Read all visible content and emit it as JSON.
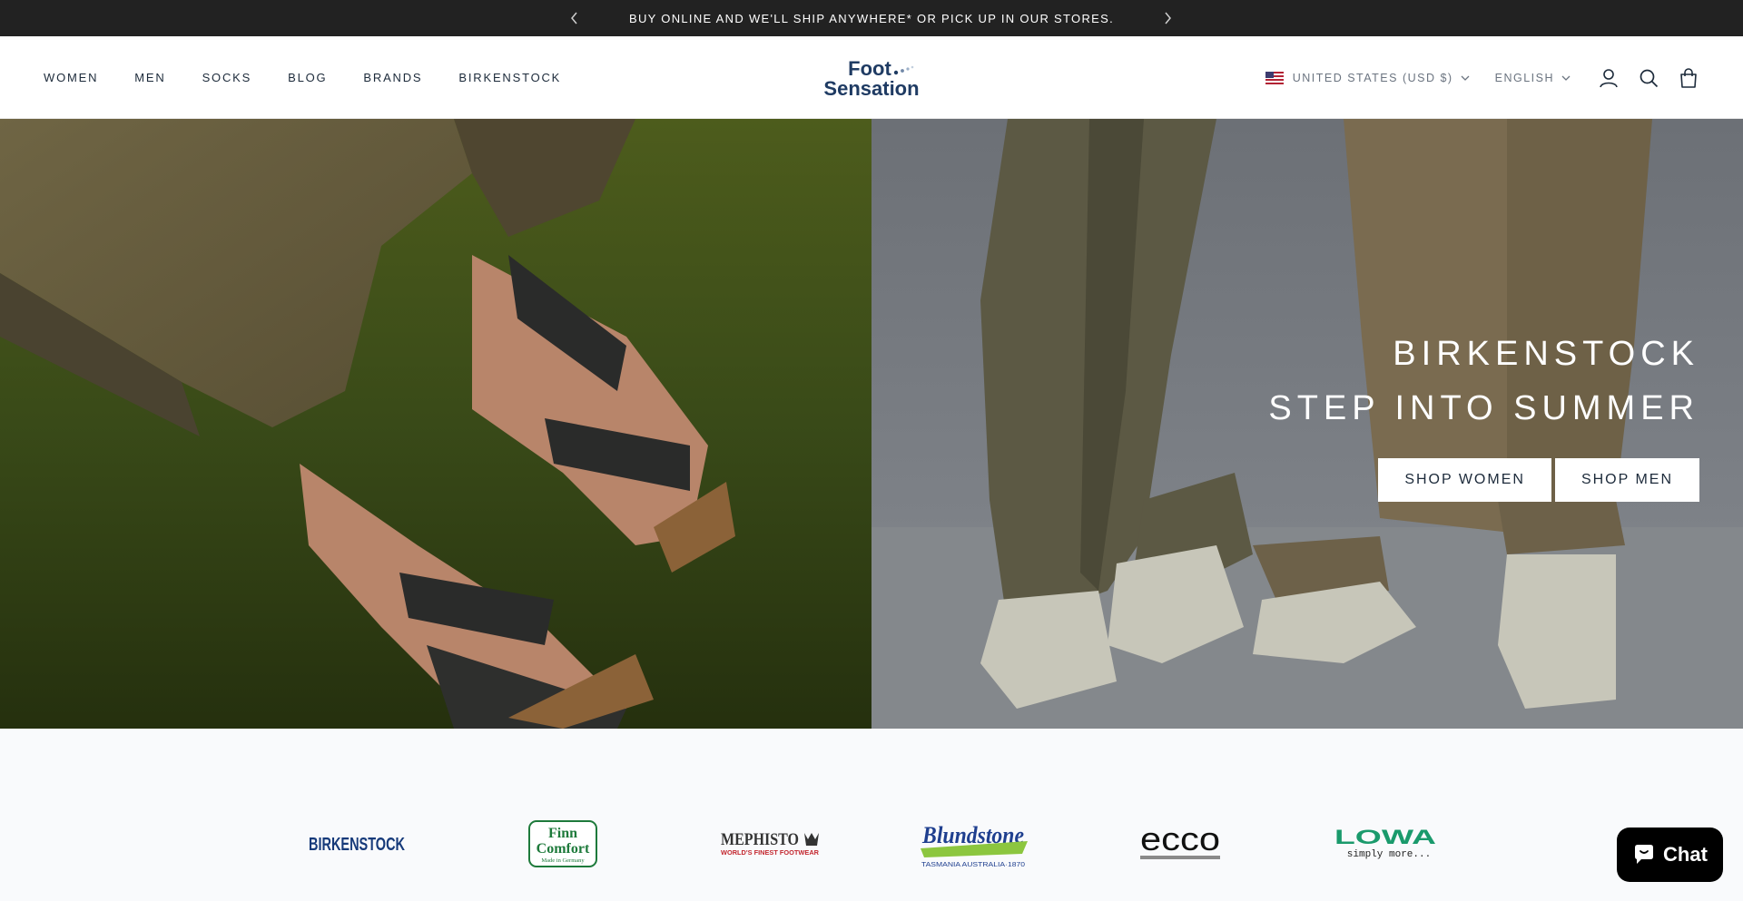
{
  "announcement": {
    "text": "BUY ONLINE AND WE'LL SHIP ANYWHERE* OR PICK UP IN OUR STORES."
  },
  "nav": {
    "items": [
      "WOMEN",
      "MEN",
      "SOCKS",
      "BLOG",
      "BRANDS",
      "BIRKENSTOCK"
    ]
  },
  "logo": {
    "line1": "Foot",
    "line2": "Sensation"
  },
  "header": {
    "country": "UNITED STATES (USD $)",
    "language": "ENGLISH"
  },
  "hero": {
    "subtitle": "BIRKENSTOCK",
    "title": "STEP INTO SUMMER",
    "buttons": [
      "SHOP WOMEN",
      "SHOP MEN"
    ]
  },
  "brands": {
    "birkenstock": "BIRKENSTOCK",
    "finn_1": "Finn",
    "finn_2": "Comfort",
    "finn_3": "Made in Germany",
    "mephisto": "MEPHISTO",
    "mephisto_tag": "WORLD'S FINEST FOOTWEAR",
    "blundstone": "Blundstone",
    "blundstone_tag": "TASMANIA AUSTRALIA·1870",
    "ecco": "ecco",
    "lowa": "LOWA",
    "lowa_tag": "simply more..."
  },
  "chat": {
    "label": "Chat"
  },
  "colors": {
    "announcement_bg": "#222222",
    "brand_navy": "#1c2a3a",
    "logo_blue": "#1f3b63",
    "chat_bg": "#000000"
  }
}
